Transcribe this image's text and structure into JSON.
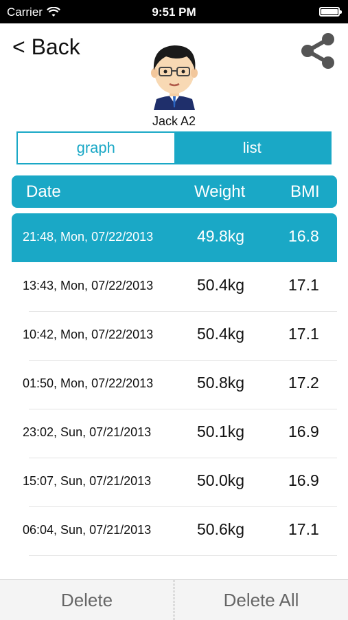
{
  "status_bar": {
    "carrier": "Carrier",
    "time": "9:51 PM"
  },
  "nav": {
    "back_label": "< Back"
  },
  "user": {
    "name": "Jack A2"
  },
  "tabs": {
    "graph": "graph",
    "list": "list",
    "selected": "list"
  },
  "table": {
    "headers": {
      "date": "Date",
      "weight": "Weight",
      "bmi": "BMI"
    },
    "rows": [
      {
        "date": "21:48, Mon, 07/22/2013",
        "weight": "49.8kg",
        "bmi": "16.8",
        "selected": true
      },
      {
        "date": "13:43, Mon, 07/22/2013",
        "weight": "50.4kg",
        "bmi": "17.1"
      },
      {
        "date": "10:42, Mon, 07/22/2013",
        "weight": "50.4kg",
        "bmi": "17.1"
      },
      {
        "date": "01:50, Mon, 07/22/2013",
        "weight": "50.8kg",
        "bmi": "17.2"
      },
      {
        "date": "23:02, Sun, 07/21/2013",
        "weight": "50.1kg",
        "bmi": "16.9"
      },
      {
        "date": "15:07, Sun, 07/21/2013",
        "weight": "50.0kg",
        "bmi": "16.9"
      },
      {
        "date": "06:04, Sun, 07/21/2013",
        "weight": "50.6kg",
        "bmi": "17.1"
      }
    ]
  },
  "actions": {
    "delete": "Delete",
    "delete_all": "Delete All"
  },
  "colors": {
    "accent": "#1aa8c6"
  }
}
